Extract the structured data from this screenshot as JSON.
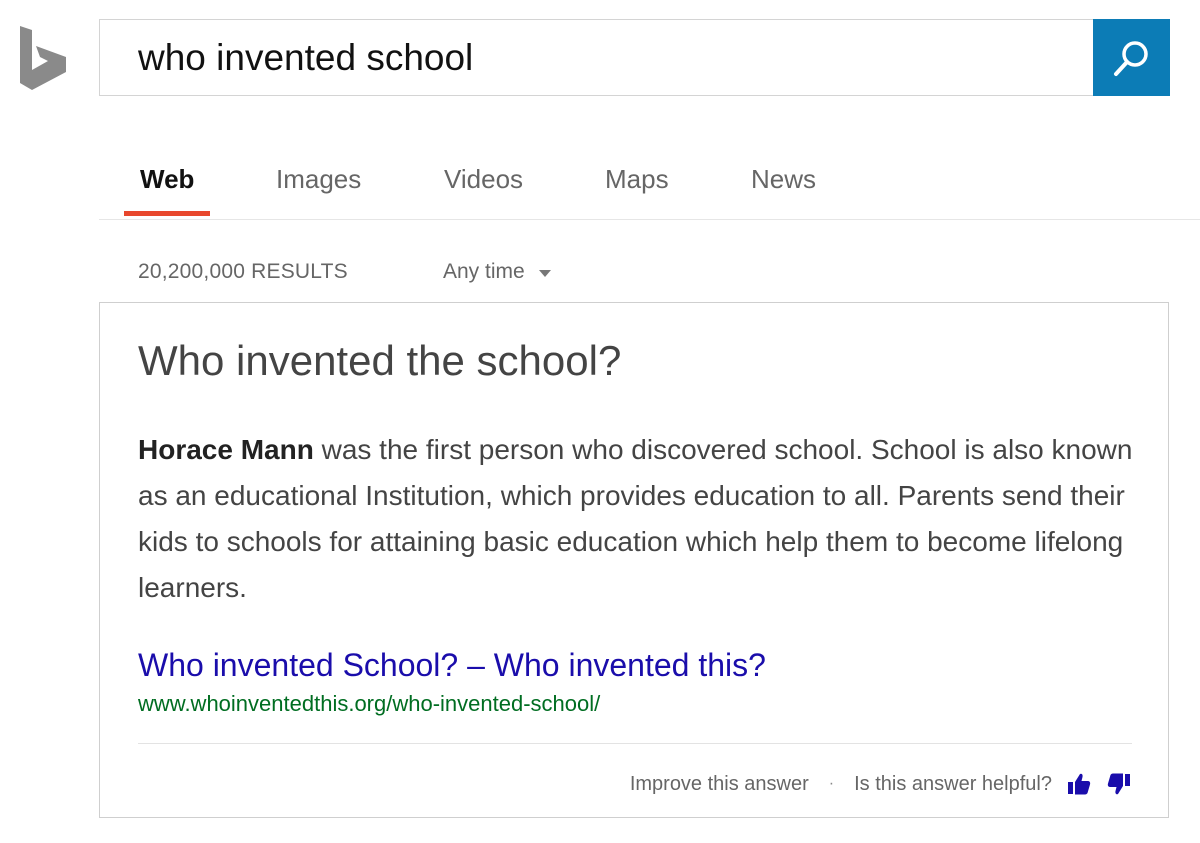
{
  "search": {
    "query": "who invented school",
    "button_icon": "search-icon"
  },
  "tabs": [
    {
      "label": "Web",
      "active": true
    },
    {
      "label": "Images",
      "active": false
    },
    {
      "label": "Videos",
      "active": false
    },
    {
      "label": "Maps",
      "active": false
    },
    {
      "label": "News",
      "active": false
    }
  ],
  "results": {
    "count": "20,200,000 RESULTS",
    "time_filter": "Any time"
  },
  "answer": {
    "question": "Who invented the school?",
    "highlight": "Horace Mann",
    "body": " was the first person who discovered school. School is also known as an educational Institution, which provides education to all. Parents send their kids to schools for attaining basic education which help them to become lifelong learners.",
    "source_title": "Who invented School? – Who invented this?",
    "source_url": "www.whoinventedthis.org/who-invented-school/"
  },
  "footer": {
    "improve": "Improve this answer",
    "separator": "·",
    "helpful": "Is this answer helpful?"
  },
  "colors": {
    "accent": "#e8472d",
    "search_button": "#0c7cb6",
    "link": "#1a0dab",
    "url": "#006d21",
    "thumb": "#1a0dab"
  }
}
